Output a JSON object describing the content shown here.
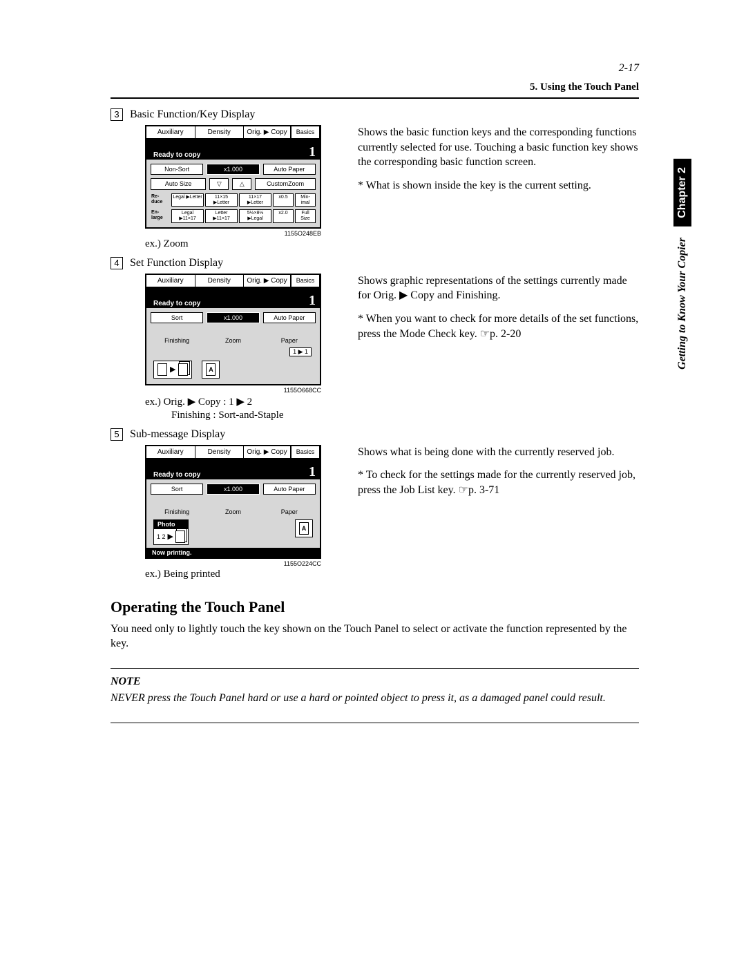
{
  "page_number": "2-17",
  "section_header": "5. Using the Touch Panel",
  "side_tab": {
    "chapter": "Chapter 2",
    "subtitle": "Getting to Know Your Copier"
  },
  "items": [
    {
      "num": "3",
      "label": "Basic Function/Key Display",
      "panel": {
        "tabs": [
          "Auxiliary",
          "Density",
          "Orig. ▶ Copy",
          "Basics"
        ],
        "status": "Ready to copy",
        "count": "1",
        "row1": [
          "Non-Sort",
          "x1.000",
          "Auto Paper"
        ],
        "row2": [
          "Auto Size",
          "▽",
          "△",
          "CustomZoom"
        ],
        "reduce": {
          "side": "Re-\nduce",
          "cells": [
            "Legal\n▶Letter",
            "11×15\n▶Letter",
            "11×17\n▶Letter",
            "x0.5",
            "Min-\nimal"
          ]
        },
        "enlarge": {
          "side": "En-\nlarge",
          "cells": [
            "Legal\n▶11×17",
            "Letter\n▶11×17",
            "5½×8½\n▶Legal",
            "x2.0",
            "Full\nSize"
          ]
        }
      },
      "code": "1155O248EB",
      "example": "ex.) Zoom",
      "desc": "Shows the basic function keys and the corresponding functions currently selected for use. Touching a basic function key shows the corresponding basic function screen.",
      "star": "* What is shown inside the key is the current setting."
    },
    {
      "num": "4",
      "label": "Set Function Display",
      "panel": {
        "tabs": [
          "Auxiliary",
          "Density",
          "Orig. ▶ Copy",
          "Basics"
        ],
        "status": "Ready to copy",
        "count": "1",
        "row1": [
          "Sort",
          "x1.000",
          "Auto Paper"
        ],
        "labels": [
          "Finishing",
          "Zoom",
          "Paper"
        ],
        "badge": "1 ▶ 1"
      },
      "code": "1155O668CC",
      "example_l1": "ex.)  Orig. ▶ Copy : 1 ▶ 2",
      "example_l2": "Finishing       : Sort-and-Staple",
      "desc": "Shows graphic representations of the settings currently made for Orig. ▶ Copy and Finishing.",
      "star": "* When you want to check for more details of the set functions, press the Mode Check key. ☞p. 2-20"
    },
    {
      "num": "5",
      "label": "Sub-message Display",
      "panel": {
        "tabs": [
          "Auxiliary",
          "Density",
          "Orig. ▶ Copy",
          "Basics"
        ],
        "status": "Ready to copy",
        "count": "1",
        "row1": [
          "Sort",
          "x1.000",
          "Auto Paper"
        ],
        "labels": [
          "Finishing",
          "Zoom",
          "Paper"
        ],
        "photo": "Photo",
        "pagelabel": "1 2",
        "footer": "Now printing."
      },
      "code": "1155O224CC",
      "example": "ex.) Being printed",
      "desc": "Shows what is being done with the currently reserved job.",
      "star": "* To check for the settings made for the currently reserved job, press the Job List key. ☞p. 3-71"
    }
  ],
  "operating": {
    "title": "Operating the Touch Panel",
    "body": "You need only to lightly touch the key shown on the Touch Panel to select or activate the function represented by the key."
  },
  "note": {
    "head": "NOTE",
    "body": "NEVER press the Touch Panel hard or use a hard or pointed object to press it, as a damaged panel could result."
  }
}
